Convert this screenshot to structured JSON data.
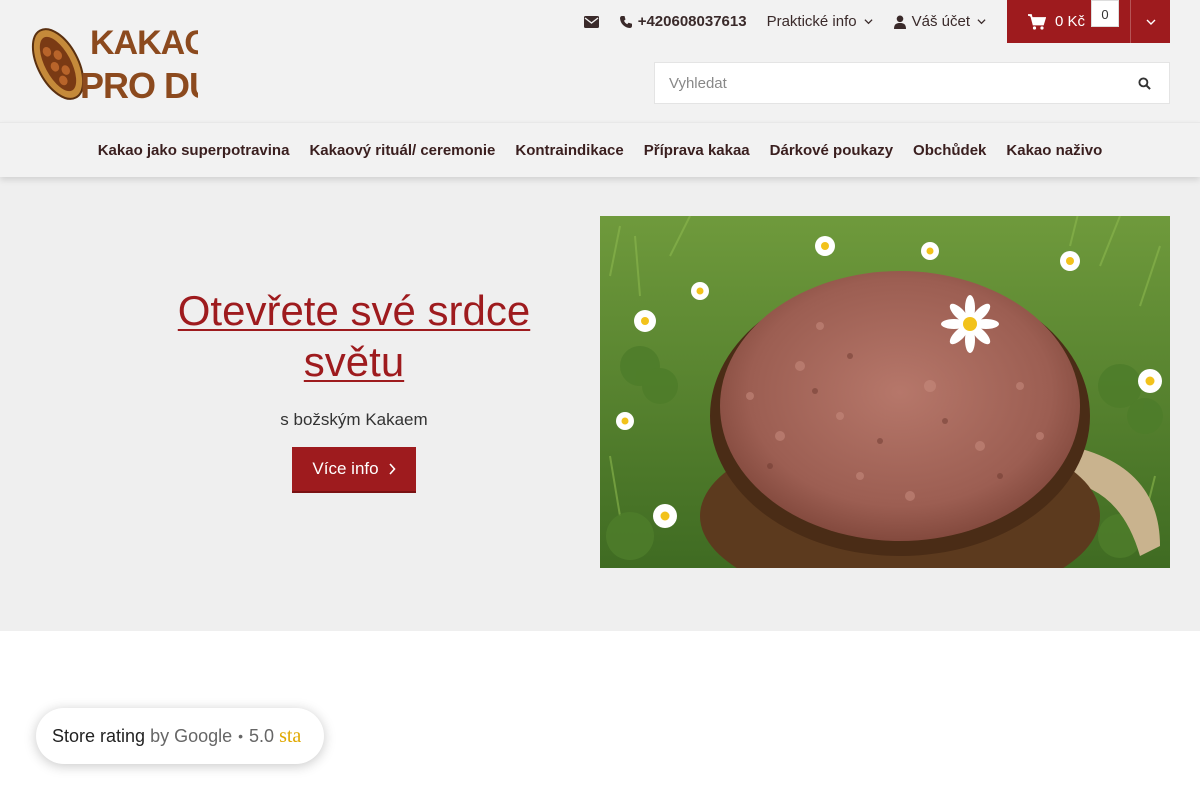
{
  "brand": {
    "logo_line1": "KAKAO",
    "logo_line2": "PRO DUŠI"
  },
  "topbar": {
    "email_icon": "envelope-icon",
    "phone_icon": "phone-icon",
    "phone": "+420608037613",
    "practical_info": "Praktické info",
    "account": "Váš účet",
    "cart_total": "0 Kč",
    "cart_count": "0"
  },
  "search": {
    "placeholder": "Vyhledat"
  },
  "nav": {
    "items": [
      "Kakao jako superpotravina",
      "Kakaový rituál/ ceremonie",
      "Kontraindikace",
      "Příprava kakaa",
      "Dárkové poukazy",
      "Obchůdek",
      "Kakao naživo"
    ]
  },
  "hero": {
    "title": "Otevřete své srdce světu",
    "subtitle": "s božským Kakaem",
    "button": "Více info"
  },
  "rating": {
    "label": "Store rating",
    "by": "by Google",
    "separator": "•",
    "score": "5.0",
    "stars_text": "sta"
  },
  "colors": {
    "accent": "#9e1b1e",
    "header_bg": "#f2f2f2",
    "hero_bg": "#efefef",
    "nav_text": "#3a1f1f"
  }
}
